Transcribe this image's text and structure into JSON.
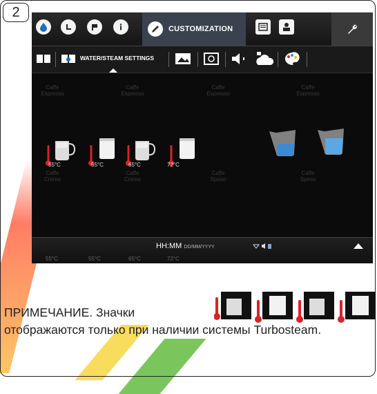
{
  "step_number": "2",
  "topbar": {
    "tabs": [
      {
        "icon": "water-drop-icon"
      },
      {
        "icon": "clock-icon"
      },
      {
        "icon": "flag-icon"
      },
      {
        "icon": "info-icon"
      }
    ],
    "active_tab_label": "CUSTOMIZATION",
    "right_icons": [
      "display-icon",
      "user-settings-icon"
    ],
    "wrench_icon": "wrench-icon"
  },
  "subbar": {
    "active_label": "WATER/STEAM SETTINGS",
    "icons": [
      "book-icon",
      "book-settings-icon",
      "image-icon",
      "clean-icon",
      "speaker-icon",
      "cloud-icon",
      "palette-icon"
    ]
  },
  "ghost_labels": [
    "Caffe\nEspresso",
    "Caffe\nEspresso",
    "Caffe\nEspresso",
    "Caffe\nEspresso",
    "Caffe\nCrema",
    "Caffe\nCrema",
    "Caffe\nSpeso",
    "Caffe\nSpeso"
  ],
  "cups": [
    {
      "temp": "55°C"
    },
    {
      "temp": "55°C"
    },
    {
      "temp": "65°C"
    },
    {
      "temp": "72°C"
    }
  ],
  "bottom_bar": {
    "time": "HH:MM",
    "date": "DD/MM/YYYY",
    "temps": [
      "55°C",
      "55°C",
      "65°C",
      "72°C"
    ]
  },
  "note": {
    "prefix": "ПРИМЕЧАНИЕ. Значки",
    "suffix": "отображаются только при наличии системы Turbosteam."
  },
  "colors": {
    "screen_bg": "#0b0b0b",
    "active_tab": "#3a4250",
    "thermometer": "#d8232a",
    "water": "#3a8ad6"
  }
}
